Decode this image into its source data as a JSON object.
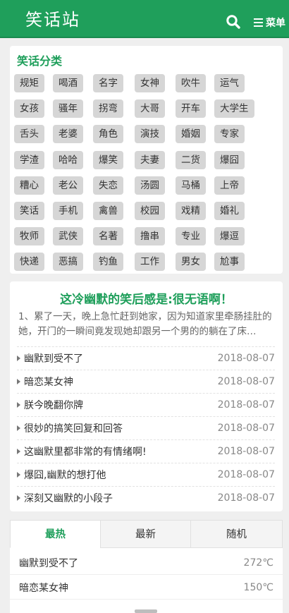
{
  "header": {
    "logo": "笑话站",
    "menu_label": "菜单",
    "search_icon": "search-icon",
    "menu_icon": "hamburger-icon"
  },
  "categories": {
    "title": "笑话分类",
    "tags": [
      "规矩",
      "喝酒",
      "名字",
      "女神",
      "吹牛",
      "运气",
      "女孩",
      "骚年",
      "拐弯",
      "大哥",
      "开车",
      "大学生",
      "舌头",
      "老婆",
      "角色",
      "演技",
      "婚姻",
      "专家",
      "学渣",
      "哈哈",
      "爆笑",
      "夫妻",
      "二货",
      "爆囧",
      "糟心",
      "老公",
      "失恋",
      "汤圆",
      "马桶",
      "上帝",
      "笑话",
      "手机",
      "禽兽",
      "校园",
      "戏精",
      "婚礼",
      "牧师",
      "武侠",
      "名著",
      "撸串",
      "专业",
      "爆逗",
      "快递",
      "恶搞",
      "钓鱼",
      "工作",
      "男女",
      "尬事"
    ]
  },
  "featured": {
    "title": "这冷幽默的笑后感是:很无语啊！",
    "excerpt": "1、累了一天，晚上急忙赶到她家，因为知道家里牵肠挂肚的她，开门的一瞬间竟发现她却跟另一个男的的躺在了床…",
    "items": [
      {
        "title": "幽默到受不了",
        "date": "2018-08-07"
      },
      {
        "title": "暗恋某女神",
        "date": "2018-08-07"
      },
      {
        "title": "朕今晚翻你牌",
        "date": "2018-08-07"
      },
      {
        "title": "很妙的搞笑回复和回答",
        "date": "2018-08-07"
      },
      {
        "title": "这幽默里都非常的有情绪啊!",
        "date": "2018-08-07"
      },
      {
        "title": "爆囧,幽默的想打他",
        "date": "2018-08-07"
      },
      {
        "title": "深刻又幽默的小段子",
        "date": "2018-08-07"
      }
    ]
  },
  "ranking": {
    "tabs": [
      "最热",
      "最新",
      "随机"
    ],
    "active_tab": 0,
    "items": [
      {
        "title": "幽默到受不了",
        "value": "272℃"
      },
      {
        "title": "暗恋某女神",
        "value": "150℃"
      }
    ]
  },
  "colors": {
    "brand": "#1f9f5b",
    "tag_bg": "#d6d6d6"
  }
}
